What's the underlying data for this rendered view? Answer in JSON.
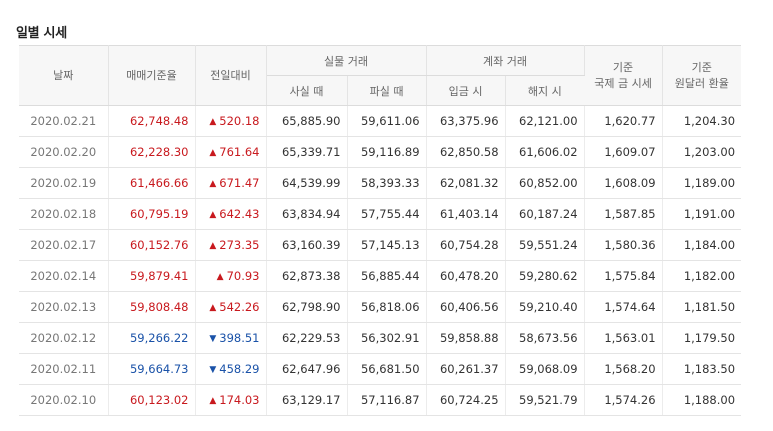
{
  "section_title": "일별 시세",
  "headers": {
    "date": "날짜",
    "trade_base": "매매기준율",
    "change": "전일대비",
    "cash_group": "실물 거래",
    "cash_buy": "사실 때",
    "cash_sell": "파실 때",
    "account_group": "계좌 거래",
    "deposit": "입금 시",
    "withdraw": "해지 시",
    "intl_line1": "기준",
    "intl_line2": "국제 금 시세",
    "fx_line1": "기준",
    "fx_line2": "원달러 환율"
  },
  "icons": {
    "up": "triangle-up-icon",
    "down": "triangle-down-icon"
  },
  "colors": {
    "up": "#c8191e",
    "down": "#1a52a8"
  },
  "rows": [
    {
      "date": "2020.02.21",
      "trade_base": "62,748.48",
      "direction": "up",
      "change": "520.18",
      "cash_buy": "65,885.90",
      "cash_sell": "59,611.06",
      "deposit": "63,375.96",
      "withdraw": "62,121.00",
      "intl_gold": "1,620.77",
      "usd_krw": "1,204.30"
    },
    {
      "date": "2020.02.20",
      "trade_base": "62,228.30",
      "direction": "up",
      "change": "761.64",
      "cash_buy": "65,339.71",
      "cash_sell": "59,116.89",
      "deposit": "62,850.58",
      "withdraw": "61,606.02",
      "intl_gold": "1,609.07",
      "usd_krw": "1,203.00"
    },
    {
      "date": "2020.02.19",
      "trade_base": "61,466.66",
      "direction": "up",
      "change": "671.47",
      "cash_buy": "64,539.99",
      "cash_sell": "58,393.33",
      "deposit": "62,081.32",
      "withdraw": "60,852.00",
      "intl_gold": "1,608.09",
      "usd_krw": "1,189.00"
    },
    {
      "date": "2020.02.18",
      "trade_base": "60,795.19",
      "direction": "up",
      "change": "642.43",
      "cash_buy": "63,834.94",
      "cash_sell": "57,755.44",
      "deposit": "61,403.14",
      "withdraw": "60,187.24",
      "intl_gold": "1,587.85",
      "usd_krw": "1,191.00"
    },
    {
      "date": "2020.02.17",
      "trade_base": "60,152.76",
      "direction": "up",
      "change": "273.35",
      "cash_buy": "63,160.39",
      "cash_sell": "57,145.13",
      "deposit": "60,754.28",
      "withdraw": "59,551.24",
      "intl_gold": "1,580.36",
      "usd_krw": "1,184.00"
    },
    {
      "date": "2020.02.14",
      "trade_base": "59,879.41",
      "direction": "up",
      "change": "70.93",
      "cash_buy": "62,873.38",
      "cash_sell": "56,885.44",
      "deposit": "60,478.20",
      "withdraw": "59,280.62",
      "intl_gold": "1,575.84",
      "usd_krw": "1,182.00"
    },
    {
      "date": "2020.02.13",
      "trade_base": "59,808.48",
      "direction": "up",
      "change": "542.26",
      "cash_buy": "62,798.90",
      "cash_sell": "56,818.06",
      "deposit": "60,406.56",
      "withdraw": "59,210.40",
      "intl_gold": "1,574.64",
      "usd_krw": "1,181.50"
    },
    {
      "date": "2020.02.12",
      "trade_base": "59,266.22",
      "direction": "down",
      "change": "398.51",
      "cash_buy": "62,229.53",
      "cash_sell": "56,302.91",
      "deposit": "59,858.88",
      "withdraw": "58,673.56",
      "intl_gold": "1,563.01",
      "usd_krw": "1,179.50"
    },
    {
      "date": "2020.02.11",
      "trade_base": "59,664.73",
      "direction": "down",
      "change": "458.29",
      "cash_buy": "62,647.96",
      "cash_sell": "56,681.50",
      "deposit": "60,261.37",
      "withdraw": "59,068.09",
      "intl_gold": "1,568.20",
      "usd_krw": "1,183.50"
    },
    {
      "date": "2020.02.10",
      "trade_base": "60,123.02",
      "direction": "up",
      "change": "174.03",
      "cash_buy": "63,129.17",
      "cash_sell": "57,116.87",
      "deposit": "60,724.25",
      "withdraw": "59,521.79",
      "intl_gold": "1,574.26",
      "usd_krw": "1,188.00"
    }
  ]
}
